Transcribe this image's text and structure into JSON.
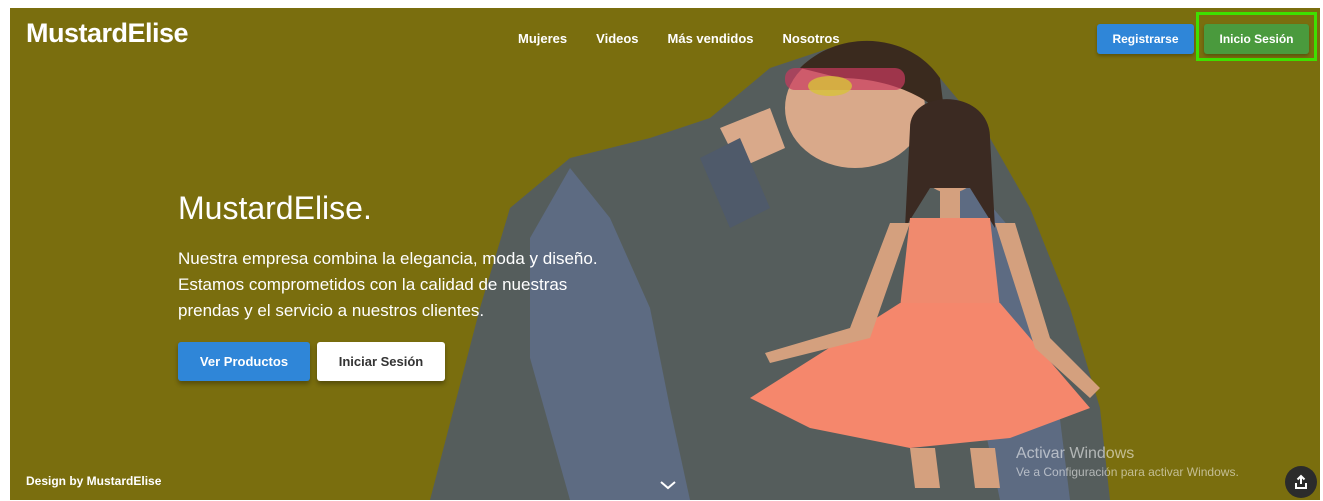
{
  "brand": "MustardElise",
  "nav": [
    "Mujeres",
    "Videos",
    "Más vendidos",
    "Nosotros"
  ],
  "header_buttons": {
    "register": "Registrarse",
    "login": "Inicio Sesión"
  },
  "hero": {
    "title": "MustardElise.",
    "lines": [
      "Nuestra empresa combina la elegancia, moda y diseño.",
      "Estamos comprometidos con la calidad de nuestras",
      "prendas y el servicio a nuestros clientes."
    ],
    "primary_button": "Ver Productos",
    "secondary_button": "Iniciar Sesión"
  },
  "footer_credit": "Design by MustardElise",
  "watermark": {
    "title": "Activar Windows",
    "subtitle": "Ve a Configuración para activar Windows."
  },
  "icons": {
    "scroll": "chevron-down-icon",
    "share": "share-icon"
  },
  "colors": {
    "hero_bg": "#7a6e0e",
    "primary": "#2f86d8",
    "login": "#4a9a3d",
    "highlight": "#3fe000"
  }
}
